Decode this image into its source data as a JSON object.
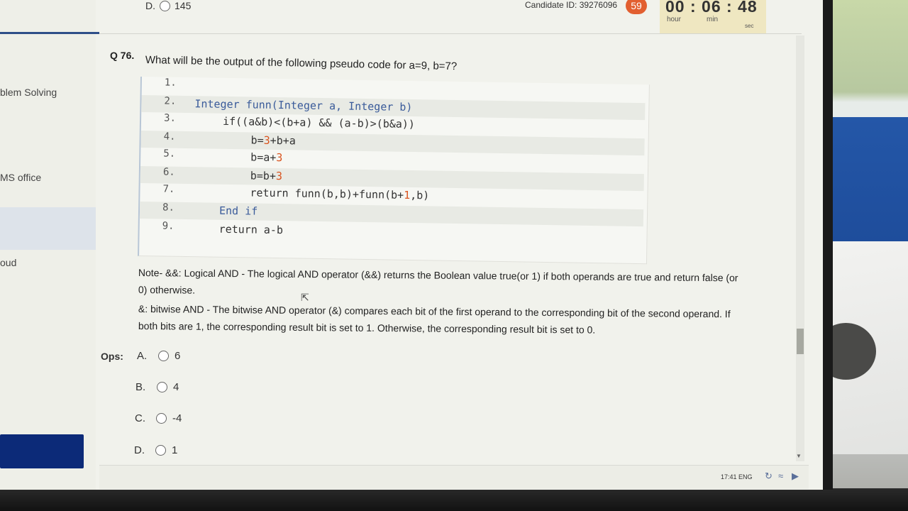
{
  "header": {
    "prev_option_letter": "D.",
    "prev_option_value": "145",
    "candidate": "Candidate ID: 39276096",
    "badge": "59",
    "timer": {
      "digits": "00 : 06 : 48",
      "hour": "hour",
      "min": "min",
      "sec": "sec"
    }
  },
  "sidebar": {
    "items": [
      "blem Solving",
      "MS office",
      "oud"
    ]
  },
  "question": {
    "number": "Q 76.",
    "text": "What will be the output of the following pseudo code for a=9, b=7?"
  },
  "code": {
    "lines": [
      {
        "n": "1.",
        "parts": []
      },
      {
        "n": "2.",
        "parts": [
          [
            "kw",
            "Integer funn(Integer a, Integer b)"
          ]
        ]
      },
      {
        "n": "3.",
        "parts": [
          [
            "",
            "if((a&b)<(b+a) && (a-b)>(b&a))"
          ]
        ]
      },
      {
        "n": "4.",
        "parts": [
          [
            "",
            "b="
          ],
          [
            "num",
            "3"
          ],
          [
            "",
            "+b+a"
          ]
        ]
      },
      {
        "n": "5.",
        "parts": [
          [
            "",
            "b=a+"
          ],
          [
            "num",
            "3"
          ]
        ]
      },
      {
        "n": "6.",
        "parts": [
          [
            "",
            "b=b+"
          ],
          [
            "num",
            "3"
          ]
        ]
      },
      {
        "n": "7.",
        "parts": [
          [
            "",
            "return funn(b,b)+funn(b+"
          ],
          [
            "num",
            "1"
          ],
          [
            "",
            ",b)"
          ]
        ]
      },
      {
        "n": "8.",
        "parts": [
          [
            "kw",
            "End if"
          ]
        ]
      },
      {
        "n": "9.",
        "parts": [
          [
            "",
            "return a-b"
          ]
        ]
      }
    ]
  },
  "note": {
    "line1": "Note- &&: Logical AND - The logical AND operator (&&) returns the Boolean value true(or 1) if both operands are true and return false (or",
    "line2": "0) otherwise.",
    "line3": "&: bitwise AND - The bitwise AND operator (&) compares each bit of the first operand to the corresponding bit of the second operand. If",
    "line4": "both bits are 1, the corresponding result bit is set to 1. Otherwise, the corresponding result bit is set to 0."
  },
  "options": {
    "label": "Ops:",
    "items": [
      {
        "letter": "A.",
        "value": "6"
      },
      {
        "letter": "B.",
        "value": "4"
      },
      {
        "letter": "C.",
        "value": "-4"
      },
      {
        "letter": "D.",
        "value": "1"
      }
    ]
  },
  "taskbar": {
    "status": "17:41  ENG"
  }
}
